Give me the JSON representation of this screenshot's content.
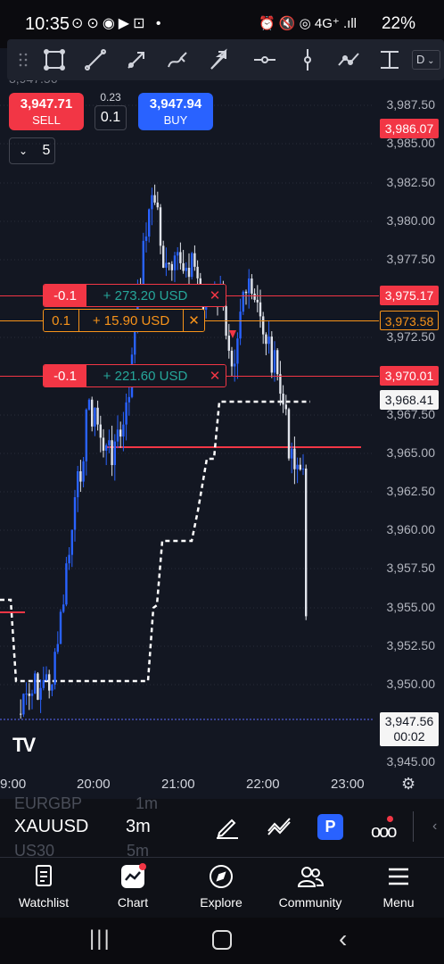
{
  "status": {
    "time": "10:35",
    "notif_icons": "⊙⊙◉▶⊡ •",
    "right_icons": "⏰ 🔇 ◎ 4G⁺ .ıll",
    "battery": "22%"
  },
  "toolbar": {
    "tools": [
      "drag-handle",
      "rectangle",
      "trend-line",
      "arrow-line",
      "brush",
      "arrow",
      "horizontal-line",
      "vertical-line",
      "path",
      "fib"
    ],
    "trailing": "D"
  },
  "trade": {
    "sell_price": "3,947.71",
    "sell_label": "SELL",
    "spread": "0.23",
    "quantity": "0.1",
    "buy_price": "3,947.94",
    "buy_label": "BUY"
  },
  "collapse": {
    "count": "5"
  },
  "top_partial_price": "3,947.56",
  "price_axis": [
    "3,987.50",
    "3,985.00",
    "3,982.50",
    "3,980.00",
    "3,977.50",
    "3,972.50",
    "3,967.50",
    "3,965.00",
    "3,962.50",
    "3,960.00",
    "3,957.50",
    "3,955.00",
    "3,952.50",
    "3,950.00",
    "3,945.00"
  ],
  "price_tags": {
    "tag1": "3,986.07",
    "tag2": "3,975.17",
    "tag3": "3,973.58",
    "tag4": "3,970.01",
    "tag5": "3,968.41",
    "last_price": "3,947.56",
    "countdown": "00:02"
  },
  "orders": [
    {
      "qty": "-0.1",
      "pnl": "+ 273.20 USD",
      "close": "✕",
      "color": "#f23645"
    },
    {
      "qty": "0.1",
      "pnl": "+ 15.90 USD",
      "close": "✕",
      "color": "#f7931a"
    },
    {
      "qty": "-0.1",
      "pnl": "+ 221.60 USD",
      "close": "✕",
      "color": "#f23645"
    }
  ],
  "time_axis": [
    "9:00",
    "20:00",
    "21:00",
    "22:00",
    "23:00"
  ],
  "logo": "TV",
  "symbols": {
    "prev": "EURGBP",
    "prev_tf": "1m",
    "current": "XAUUSD",
    "timeframe": "3m",
    "next": "US30",
    "next_tf": "5m"
  },
  "nav": [
    "Watchlist",
    "Chart",
    "Explore",
    "Community",
    "Menu"
  ],
  "colors": {
    "red": "#f23645",
    "blue": "#2962ff",
    "orange": "#f7931a",
    "bg": "#131722"
  }
}
